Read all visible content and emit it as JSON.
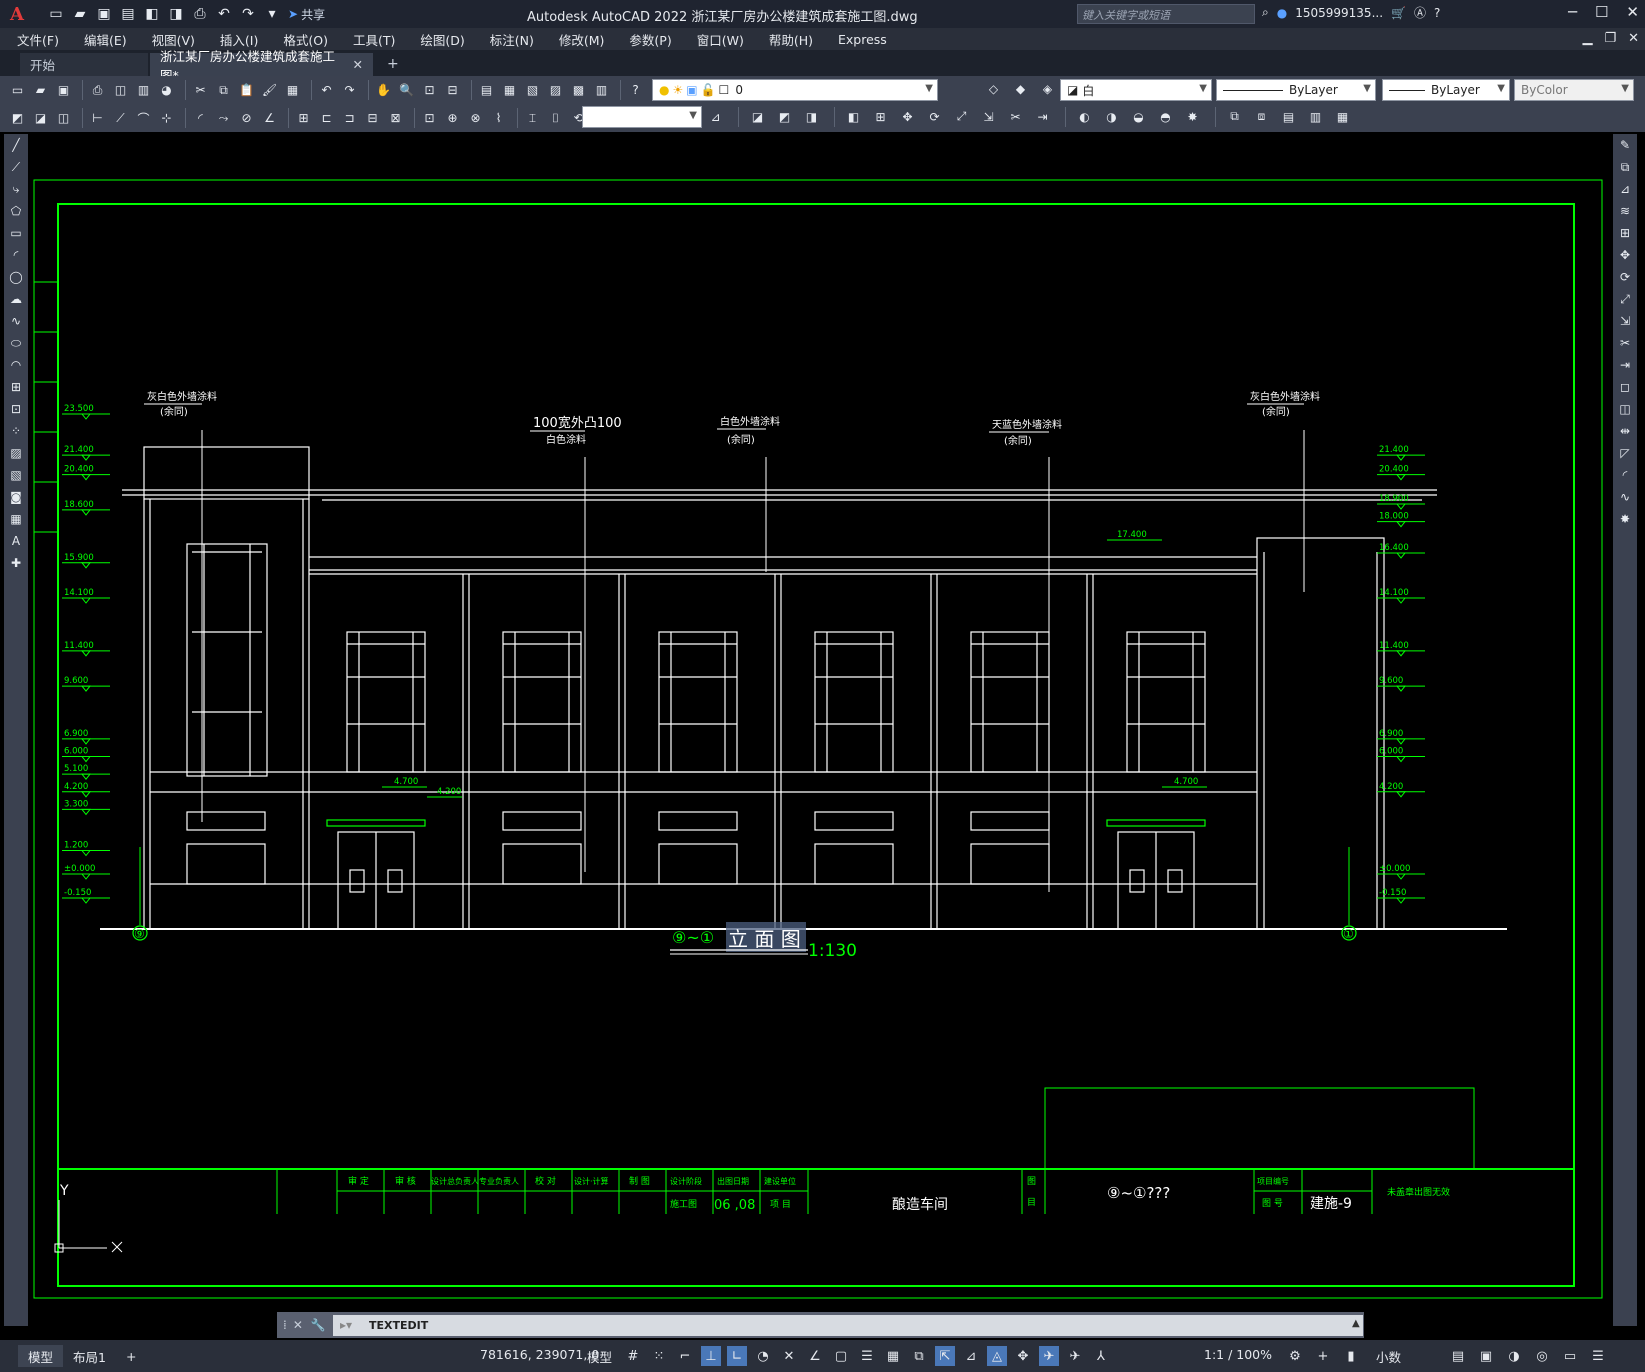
{
  "app": {
    "title": "Autodesk AutoCAD 2022   浙江某厂房办公楼建筑成套施工图.dwg",
    "search_placeholder": "键入关键字或短语",
    "user": "1505999135...",
    "share_label": "共享"
  },
  "menu": [
    "文件(F)",
    "编辑(E)",
    "视图(V)",
    "插入(I)",
    "格式(O)",
    "工具(T)",
    "绘图(D)",
    "标注(N)",
    "修改(M)",
    "参数(P)",
    "窗口(W)",
    "帮助(H)",
    "Express"
  ],
  "tabs": {
    "start": "开始",
    "active": "浙江某厂房办公楼建筑成套施工图*"
  },
  "props": {
    "layer": "0",
    "color": "白",
    "linetype": "ByLayer",
    "lineweight": "ByLayer",
    "plotstyle": "ByColor"
  },
  "drawing": {
    "annotations": {
      "left_wall": "灰白色外墙涂料",
      "left_wall_sub": "(余同)",
      "wall_100": "100宽外凸100",
      "wall_100_sub": "白色涂料",
      "wall_white": "白色外墙涂料",
      "wall_white_sub": "(余同)",
      "wall_blue": "天蓝色外墙涂料",
      "wall_blue_sub": "(余同)",
      "right_wall": "灰白色外墙涂料",
      "right_wall_sub": "(余同)"
    },
    "left_levels": [
      "23.500",
      "21.400",
      "20.400",
      "18.600",
      "15.900",
      "14.100",
      "11.400",
      "9.600",
      "6.900",
      "6.000",
      "5.100",
      "4.200",
      "3.300",
      "1.200",
      "±0.000",
      "-0.150"
    ],
    "right_levels": [
      "21.400",
      "20.400",
      "18.900",
      "18.000",
      "16.400",
      "14.100",
      "11.400",
      "9.600",
      "6.900",
      "6.000",
      "4.200",
      "±0.000",
      "-0.150"
    ],
    "mid_level": "17.400",
    "canopy_level": "4.700",
    "canopy_level_2": "4.200",
    "axis_left": "⑨",
    "axis_right": "①",
    "view_title_prefix": "⑨~①",
    "view_title_edit": "立 面 图",
    "view_scale": "1:130",
    "title_block": {
      "headers": [
        "审 定",
        "审 核",
        "设计总负责人",
        "专业负责人",
        "校 对",
        "设计·计算",
        "制 图",
        "设计阶段",
        "出图日期",
        "建设单位"
      ],
      "stage": "施工图",
      "date": "06 ,08",
      "project_label": "项 目",
      "project_name": "酿造车间",
      "map_label_1": "图",
      "map_label_2": "目",
      "sheet_title": "⑨~①???",
      "project_no_label": "项目编号",
      "sheet_no_label": "图 号",
      "sheet_no": "建施-9",
      "stamp": "未盖章出图无效"
    },
    "ucs_y": "Y"
  },
  "command": {
    "text": "TEXTEDIT"
  },
  "status": {
    "model_tab": "模型",
    "layout_tab": "布局1",
    "coords": "781616, 239071, 0",
    "space": "模型",
    "scale": "1:1 / 100%",
    "units": "小数"
  }
}
